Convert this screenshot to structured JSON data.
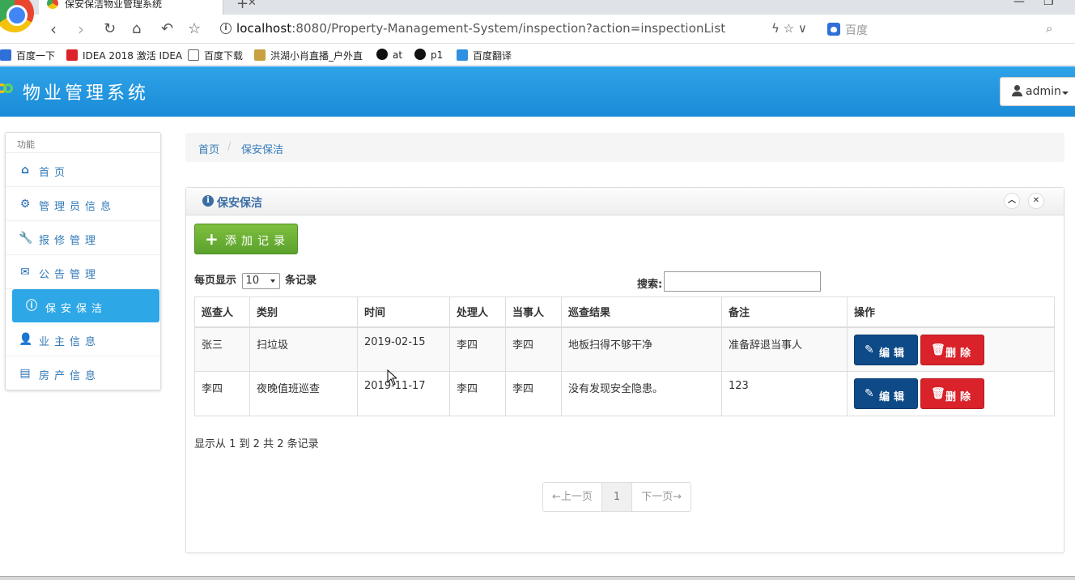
{
  "browser": {
    "tab_title": "保安保洁物业管理系统",
    "url_host": "localhost",
    "url_path": ":8080/Property-Management-System/inspection?action=inspectionList",
    "search_placeholder": "百度",
    "bookmarks": [
      "百度一下",
      "IDEA 2018 激活 IDEA",
      "百度下载",
      "洪湖小肖直播_户外直",
      "at",
      "p1",
      "百度翻译"
    ]
  },
  "header": {
    "brand": "物业管理系统",
    "user": "admin"
  },
  "sidebar": {
    "heading": "功能",
    "items": [
      {
        "label": "首页",
        "icon": "home-icon"
      },
      {
        "label": "管理员信息",
        "icon": "gear-icon"
      },
      {
        "label": "报修管理",
        "icon": "wrench-icon"
      },
      {
        "label": "公告管理",
        "icon": "envelope-icon"
      },
      {
        "label": "保安保洁",
        "icon": "info-icon"
      },
      {
        "label": "业主信息",
        "icon": "user-icon"
      },
      {
        "label": "房产信息",
        "icon": "list-icon"
      }
    ]
  },
  "breadcrumb": {
    "home": "首页",
    "separator": "/",
    "current": "保安保洁"
  },
  "panel": {
    "title": "保安保洁",
    "add_label": "添加记录",
    "length_prefix": "每页显示",
    "length_value": "10",
    "length_suffix": "条记录",
    "search_label": "搜索:",
    "columns": [
      "巡查人",
      "类别",
      "时间",
      "处理人",
      "当事人",
      "巡查结果",
      "备注",
      "操作"
    ],
    "rows": [
      {
        "inspector": "张三",
        "category": "扫垃圾",
        "time": "2019-02-15",
        "handler": "李四",
        "party": "李四",
        "result": "地板扫得不够干净",
        "remark": "准备辞退当事人"
      },
      {
        "inspector": "李四",
        "category": "夜晚值班巡查",
        "time": "2019-11-17",
        "handler": "李四",
        "party": "李四",
        "result": "没有发现安全隐患。",
        "remark": "123"
      }
    ],
    "edit_label": "编辑",
    "delete_label": "删除",
    "info_text": "显示从 1 到 2 共 2 条记录",
    "pager": {
      "prev": "←上一页",
      "current": "1",
      "next": "下一页→"
    }
  },
  "colors": {
    "header_blue": "#1a8bd8",
    "active_item": "#2ea7e6",
    "add_green": "#5ba12d",
    "edit_navy": "#0e4a87",
    "delete_red": "#d9222a"
  }
}
